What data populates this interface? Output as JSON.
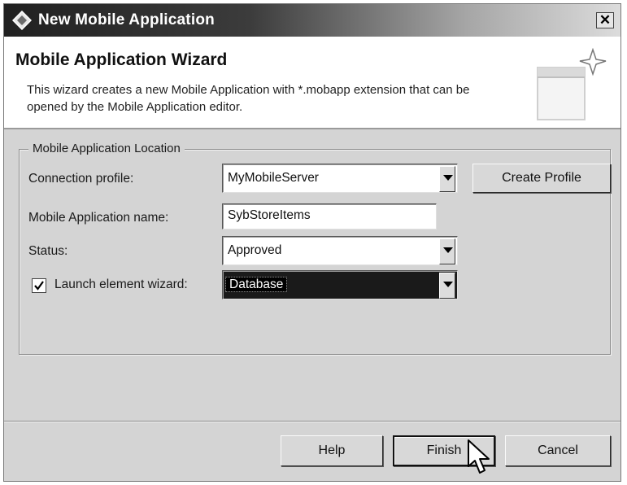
{
  "window": {
    "title": "New Mobile Application",
    "close_label": "✕"
  },
  "header": {
    "title": "Mobile Application Wizard",
    "description": "This wizard creates a new Mobile Application with *.mobapp extension that can be opened by the Mobile Application editor."
  },
  "location_group": {
    "legend": "Mobile Application Location",
    "connection_profile": {
      "label": "Connection profile:",
      "value": "MyMobileServer"
    },
    "create_profile_label": "Create Profile",
    "app_name": {
      "label": "Mobile Application name:",
      "value": "SybStoreItems"
    },
    "status": {
      "label": "Status:",
      "value": "Approved"
    },
    "launch_wizard": {
      "label": "Launch element wizard:",
      "checked": true,
      "value": "Database"
    }
  },
  "buttons": {
    "help": "Help",
    "finish": "Finish",
    "cancel": "Cancel"
  },
  "icons": {
    "app_icon": "diamond-icon",
    "dropdown": "chevron-down-icon",
    "cursor": "mouse-pointer-icon"
  }
}
